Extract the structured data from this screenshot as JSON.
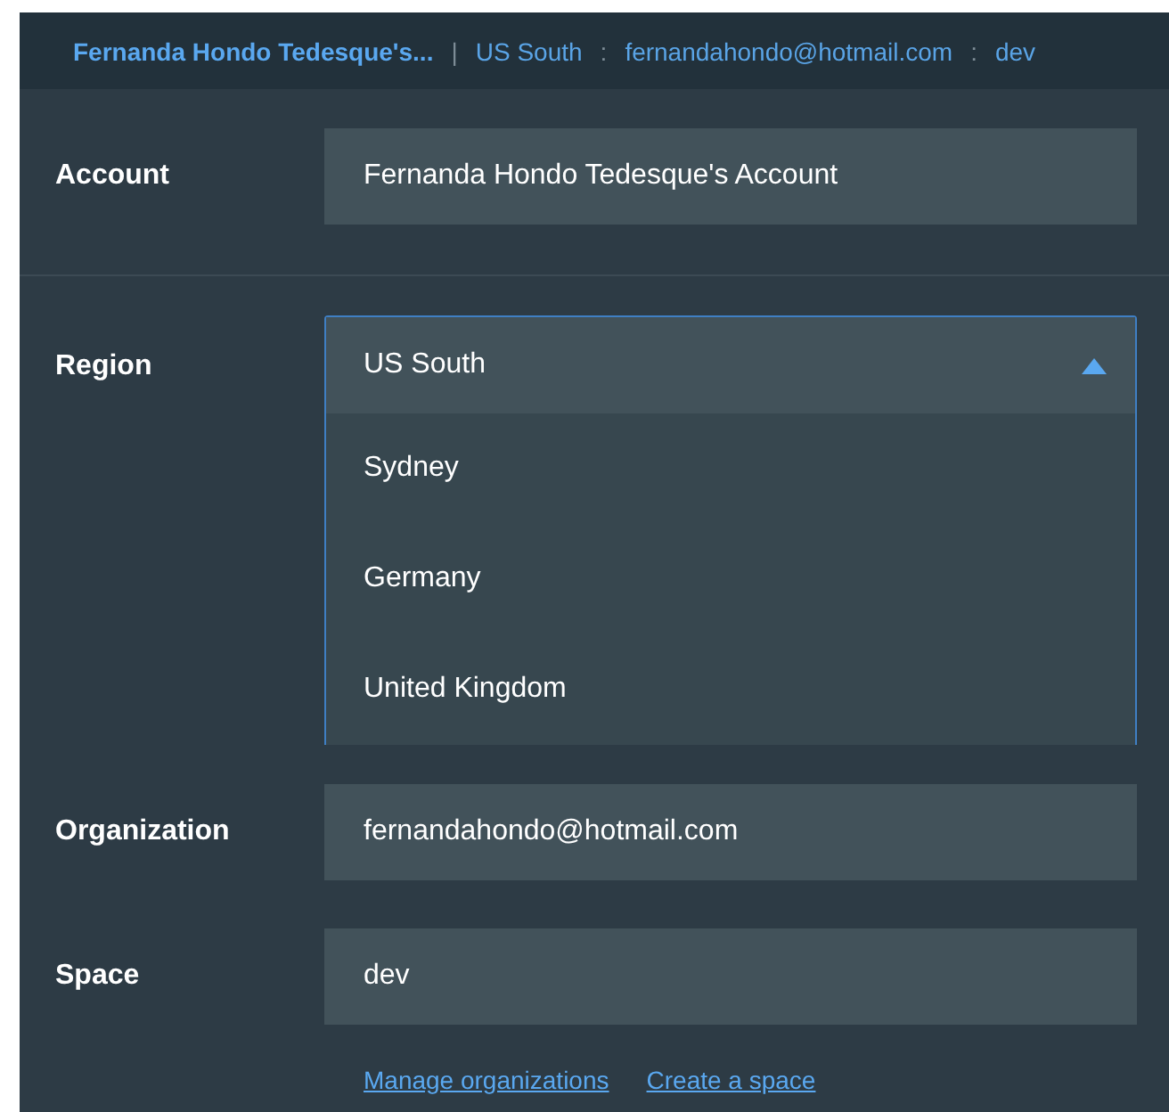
{
  "header": {
    "account": "Fernanda Hondo Tedesque's...",
    "separator": "|",
    "region": "US South",
    "colon_1": ":",
    "organization": "fernandahondo@hotmail.com",
    "colon_2": ":",
    "space": "dev"
  },
  "account": {
    "label": "Account",
    "value": "Fernanda Hondo Tedesque's Account"
  },
  "region": {
    "label": "Region",
    "value": "US South",
    "expanded": true,
    "options": [
      {
        "label": "Sydney",
        "selected": false
      },
      {
        "label": "Germany",
        "selected": false
      },
      {
        "label": "United Kingdom",
        "selected": false
      }
    ]
  },
  "organization": {
    "label": "Organization",
    "value": "fernandahondo@hotmail.com"
  },
  "space": {
    "label": "Space",
    "value": "dev"
  },
  "links": [
    "Manage organizations",
    "Create a space"
  ]
}
